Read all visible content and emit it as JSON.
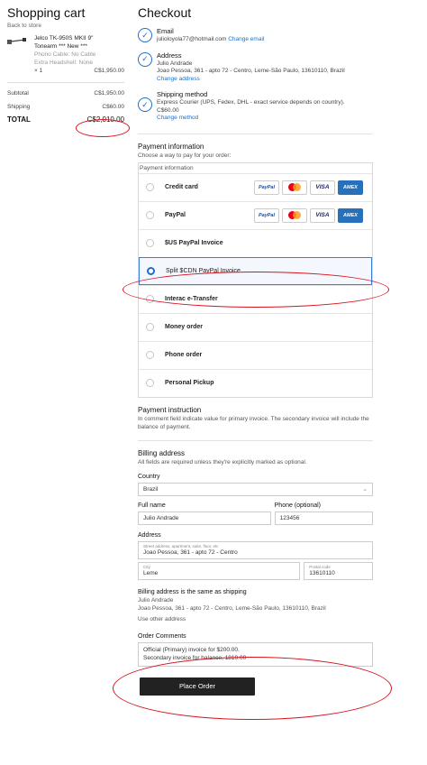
{
  "cart": {
    "title": "Shopping cart",
    "back_link": "Back to store",
    "item": {
      "name_line1": "Jelco TK-950S MKII 9\"",
      "name_line2": "Tonearm *** New ***",
      "option1": "Phono Cable: No Cable",
      "option2": "Extra Headshell: None",
      "qty": "× 1",
      "price": "C$1,950.00"
    },
    "subtotal_label": "Subtotal",
    "subtotal_value": "C$1,950.00",
    "shipping_label": "Shipping",
    "shipping_value": "C$60.00",
    "total_label": "TOTAL",
    "total_value": "C$2,010.00"
  },
  "checkout": {
    "title": "Checkout",
    "email": {
      "title": "Email",
      "value": "julioloyola77@hotmail.com",
      "change": "Change email"
    },
    "address": {
      "title": "Address",
      "name": "Julio Andrade",
      "line": "Joao Pessoa, 361 - apto 72 - Centro, Leme-São Paulo, 13610110, Brazil",
      "change": "Change address"
    },
    "shipping": {
      "title": "Shipping method",
      "desc": "Express Courier (UPS, Fedex, DHL - exact service depends on country).",
      "price": "C$60.00",
      "change": "Change method"
    },
    "payment": {
      "title": "Payment information",
      "subtitle": "Choose a way to pay for your order:",
      "legend": "Payment information",
      "options": [
        {
          "label": "Credit card"
        },
        {
          "label": "PayPal"
        },
        {
          "label": "$US PayPal Invoice"
        },
        {
          "label": "Split $CDN PayPal Invoice"
        },
        {
          "label": "Interac e-Transfer"
        },
        {
          "label": "Money order"
        },
        {
          "label": "Phone order"
        },
        {
          "label": "Personal Pickup"
        }
      ],
      "logos": {
        "paypal": "PayPal",
        "visa": "VISA",
        "amex": "AMEX"
      }
    },
    "instruction": {
      "title": "Payment instruction",
      "text": "In comment field indicate value for primary invoice. The secondary invoice will include the balance of payment."
    },
    "billing": {
      "title": "Billing address",
      "note": "All fields are required unless they're explicitly marked as optional.",
      "country_label": "Country",
      "country_value": "Brazil",
      "fullname_label": "Full name",
      "fullname_value": "Julio Andrade",
      "phone_label": "Phone (optional)",
      "phone_value": "123456",
      "address_label": "Address",
      "street_mini": "Street address, apartment, suite, floor, etc",
      "street_value": "Joao Pessoa, 361 - apto 72 - Centro",
      "city_mini": "City",
      "city_value": "Leme",
      "postal_mini": "Postal code",
      "postal_value": "13610110",
      "same_title": "Billing address is the same as shipping",
      "same_name": "Julio Andrade",
      "same_line": "Joao Pessoa, 361 - apto 72 - Centro, Leme-São Paulo, 13610110, Brazil",
      "use_other": "Use other address"
    },
    "comments": {
      "title": "Order Comments",
      "line1": "Official (Primary) invoice for $200.00.",
      "line2": "Secondary invoice for balance, 1810.00"
    },
    "place_order": "Place Order"
  },
  "colors": {
    "accent": "#1e6fc9",
    "annotation": "#d8141e",
    "button": "#222222"
  }
}
